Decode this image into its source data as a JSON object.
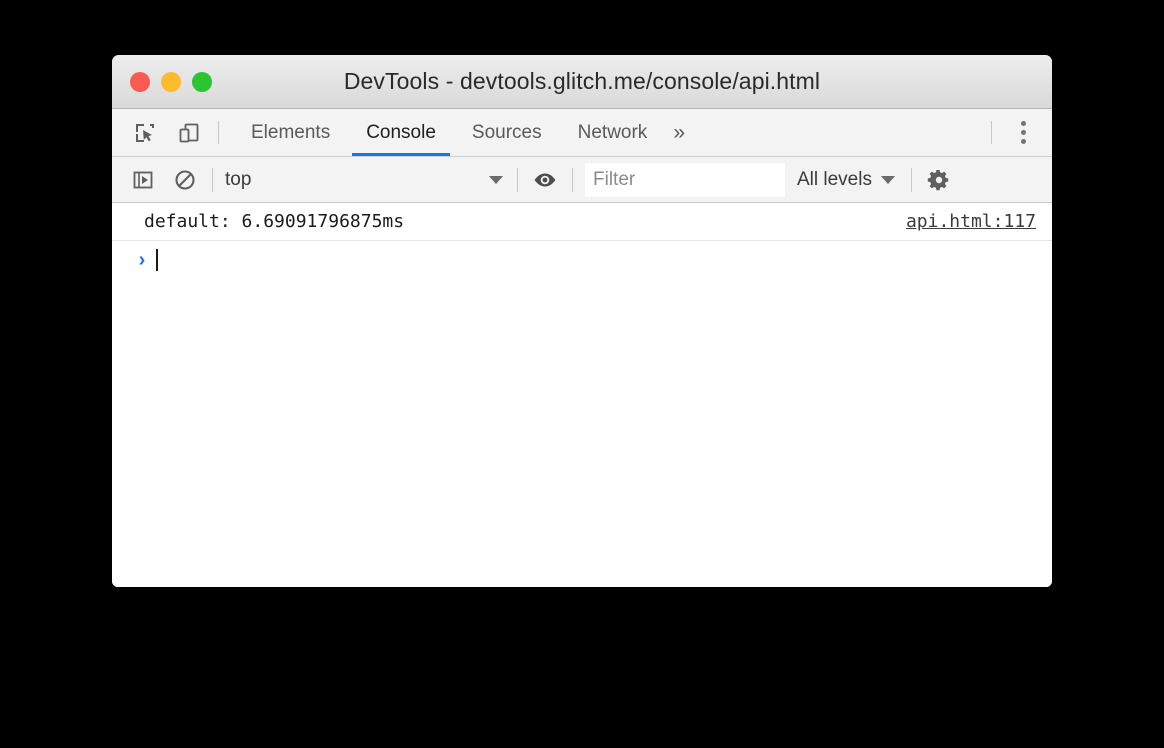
{
  "window": {
    "title": "DevTools - devtools.glitch.me/console/api.html",
    "traffic_lights": [
      {
        "name": "close",
        "color": "#fb5a51"
      },
      {
        "name": "minimize",
        "color": "#fcbc2d"
      },
      {
        "name": "zoom",
        "color": "#2ac530"
      }
    ]
  },
  "theme": {
    "accent": "#1a73e8",
    "toolbar_bg": "#f3f3f3",
    "titlebar_bg": "#e3e3e3",
    "body_bg": "#ffffff",
    "text": "#3b3b3b",
    "link": "#3b3b3b"
  },
  "tabbar": {
    "left_icons": [
      {
        "name": "inspect-element-icon",
        "title": "Inspect element"
      },
      {
        "name": "device-toolbar-icon",
        "title": "Toggle device toolbar"
      }
    ],
    "tabs": [
      {
        "label": "Elements",
        "active": false
      },
      {
        "label": "Console",
        "active": true
      },
      {
        "label": "Sources",
        "active": false
      },
      {
        "label": "Network",
        "active": false
      }
    ],
    "more_tabs_label": "»",
    "menu_icon": "more-vertical-icon"
  },
  "console_toolbar": {
    "sidebar_toggle_icon": "console-sidebar-icon",
    "clear_console_icon": "clear-console-icon",
    "context": {
      "value": "top",
      "options": [
        "top"
      ]
    },
    "live_expression_icon": "eye-icon",
    "filter": {
      "value": "",
      "placeholder": "Filter"
    },
    "levels": {
      "value": "All levels",
      "options": [
        "All levels"
      ]
    },
    "settings_icon": "gear-icon"
  },
  "console": {
    "messages": [
      {
        "text": "default: 6.69091796875ms",
        "source": "api.html:117"
      }
    ],
    "prompt": {
      "chevron": "›",
      "value": "",
      "placeholder": ""
    }
  }
}
